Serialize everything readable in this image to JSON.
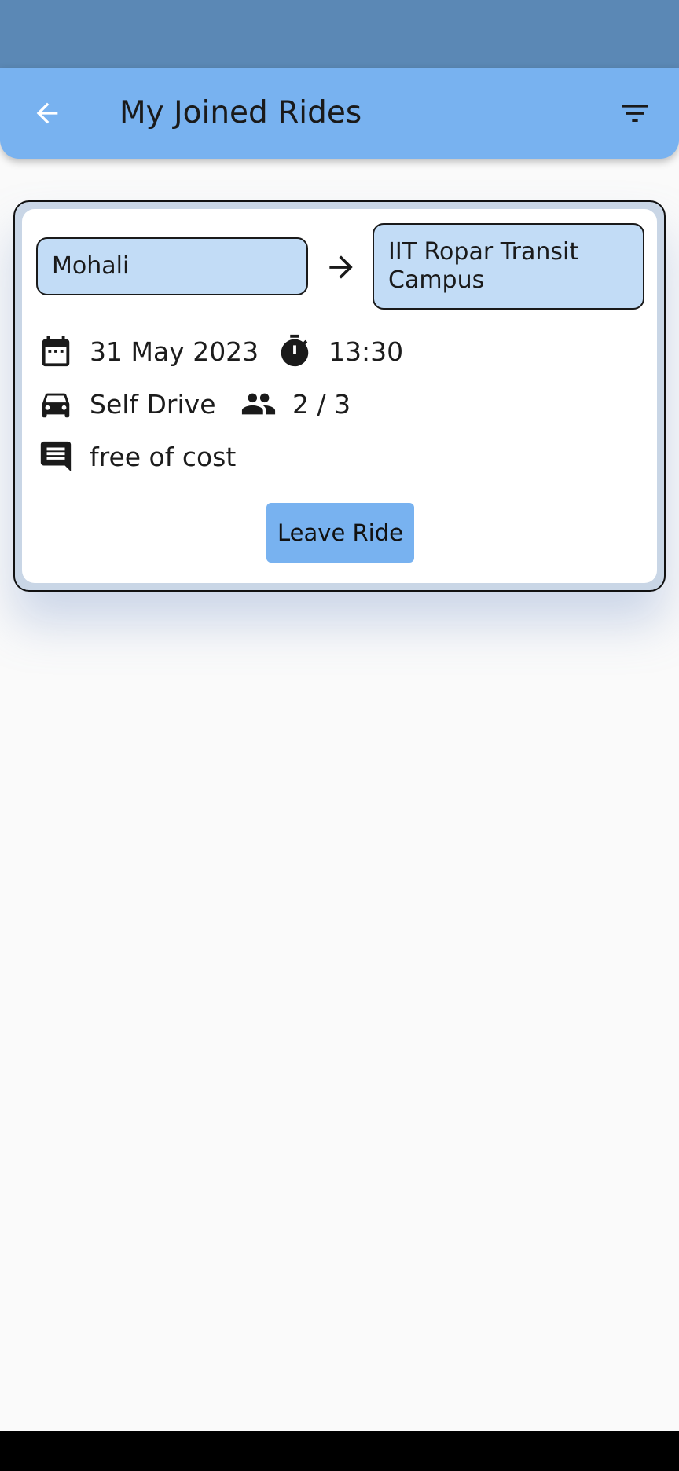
{
  "header": {
    "title": "My Joined Rides",
    "back_icon": "arrow-left-icon",
    "filter_icon": "filter-list-icon",
    "color": "#78b2f0"
  },
  "ride": {
    "from": "Mohali",
    "to": "IIT Ropar Transit Campus",
    "date": "31 May 2023",
    "time": "13:30",
    "vehicle": "Self Drive",
    "seats": "2 / 3",
    "note": "free of cost",
    "leave_label": "Leave Ride"
  },
  "colors": {
    "status_bar": "#5b88b5",
    "location_fill": "#c2dcf6",
    "button": "#78b2f0"
  }
}
